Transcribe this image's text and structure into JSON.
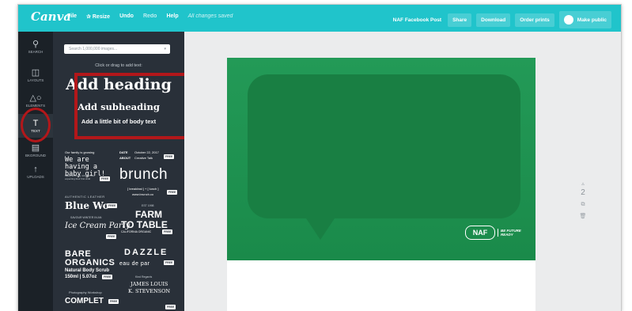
{
  "topbar": {
    "logo": "Canva",
    "menu": [
      "File",
      "✰ Resize",
      "Undo",
      "Redo",
      "Help"
    ],
    "saved_status": "All changes saved",
    "doc_title": "NAF Facebook Post",
    "share_label": "Share",
    "download_label": "Download",
    "order_label": "Order prints",
    "public_label": "Make public"
  },
  "rail": [
    {
      "label": "SEARCH",
      "icon": "search-icon"
    },
    {
      "label": "LAYOUTS",
      "icon": "layout-icon"
    },
    {
      "label": "ELEMENTS",
      "icon": "shapes-icon"
    },
    {
      "label": "TEXT",
      "icon": "text-icon"
    },
    {
      "label": "BKGROUND",
      "icon": "background-icon"
    },
    {
      "label": "UPLOADS",
      "icon": "upload-icon"
    }
  ],
  "panel": {
    "search_placeholder": "Search 1,000,000 images...",
    "hint": "Click or drag to add text:",
    "heading": "Add heading",
    "subheading": "Add subheading",
    "body_text": "Add a little bit of body text",
    "free_badge": "FREE",
    "templates": {
      "family": "Our family is growing",
      "baby": "We are having a baby girl!",
      "baby_small": "Mikey and Amy Johnson are expecting their first child",
      "date": "DATE",
      "date_value": "October 22, 2017",
      "about": "ABOUT",
      "about_value": "Creative Talk",
      "brunch": "brunch",
      "brunch_sub": "[ breakfast ] + [ lunch ]",
      "brunch_url": "www.brunch.co",
      "leather": "AUTHENTIC LEATHER",
      "bluewo": "Blue Wo",
      "farm_top": "EST 1998",
      "farm": "FARM",
      "table": "TO TABLE",
      "california": "CALIFORNIA ORGANIC",
      "icecream_top": "SAVOUR WINTER IN AN",
      "icecream": "Ice Cream Party",
      "bare": "BARE",
      "organics": "ORGANICS",
      "scrub": "Natural Body Scrub",
      "oz": "150ml | 5.07oz",
      "dazzle": "DAZZLE",
      "eau": "eau de par",
      "kindly": "Kind Regards",
      "james": "JAMES LOUIS",
      "stevenson": "K. STEVENSON",
      "photo": "Photography Workshop",
      "complete": "COMPLET"
    }
  },
  "canvas": {
    "logo": "NAF",
    "tagline_1": "BE FUTURE",
    "tagline_2": "READY",
    "page_number": "2"
  },
  "colors": {
    "topbar": "#20c4cb",
    "panel": "#293039",
    "highlight": "#b3171a",
    "post_green": "#1e9150"
  }
}
